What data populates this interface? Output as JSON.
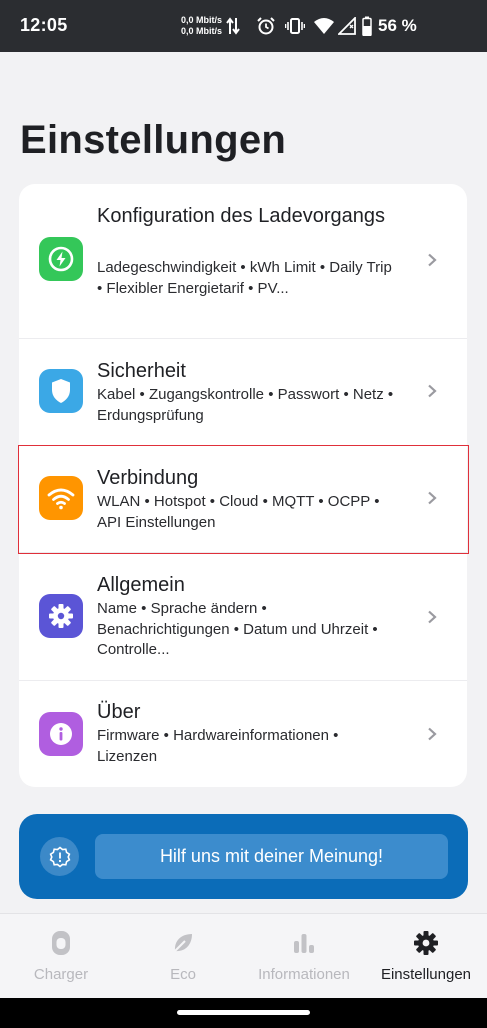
{
  "status_bar": {
    "time": "12:05",
    "net_up": "0,0 Mbit/s",
    "net_down": "0,0 Mbit/s",
    "battery": "56 %",
    "icons": [
      "data-arrows-icon",
      "alarm-icon",
      "vibrate-icon",
      "wifi-icon",
      "signal-icon",
      "battery-icon"
    ]
  },
  "page": {
    "title": "Einstellungen"
  },
  "settings": [
    {
      "title": "Konfiguration des Ladevorgangs",
      "subtitle": "Ladegeschwindigkeit • kWh Limit • Daily Trip • Flexibler Energietarif • PV...",
      "icon": "lightning-icon",
      "color": "#34c759"
    },
    {
      "title": "Sicherheit",
      "subtitle": "Kabel • Zugangskontrolle • Passwort • Netz • Erdungsprüfung",
      "icon": "shield-icon",
      "color": "#3ba8e6"
    },
    {
      "title": "Verbindung",
      "subtitle": "WLAN • Hotspot • Cloud • MQTT • OCPP • API Einstellungen",
      "icon": "wifi-icon",
      "color": "#ff9500"
    },
    {
      "title": "Allgemein",
      "subtitle": "Name • Sprache ändern • Benachrichtigungen • Datum und Uhrzeit • Controlle...",
      "icon": "gear-icon",
      "color": "#5b55d6"
    },
    {
      "title": "Über",
      "subtitle": "Firmware • Hardwareinformationen • Lizenzen",
      "icon": "info-icon",
      "color": "#b05ee0"
    }
  ],
  "feedback": {
    "button_label": "Hilf uns mit deiner Meinung!",
    "icon": "feedback-badge-icon"
  },
  "bottom_nav": [
    {
      "label": "Charger",
      "icon": "charger-icon",
      "active": false
    },
    {
      "label": "Eco",
      "icon": "leaf-icon",
      "active": false
    },
    {
      "label": "Informationen",
      "icon": "bar-chart-icon",
      "active": false
    },
    {
      "label": "Einstellungen",
      "icon": "gear-icon",
      "active": true
    }
  ]
}
